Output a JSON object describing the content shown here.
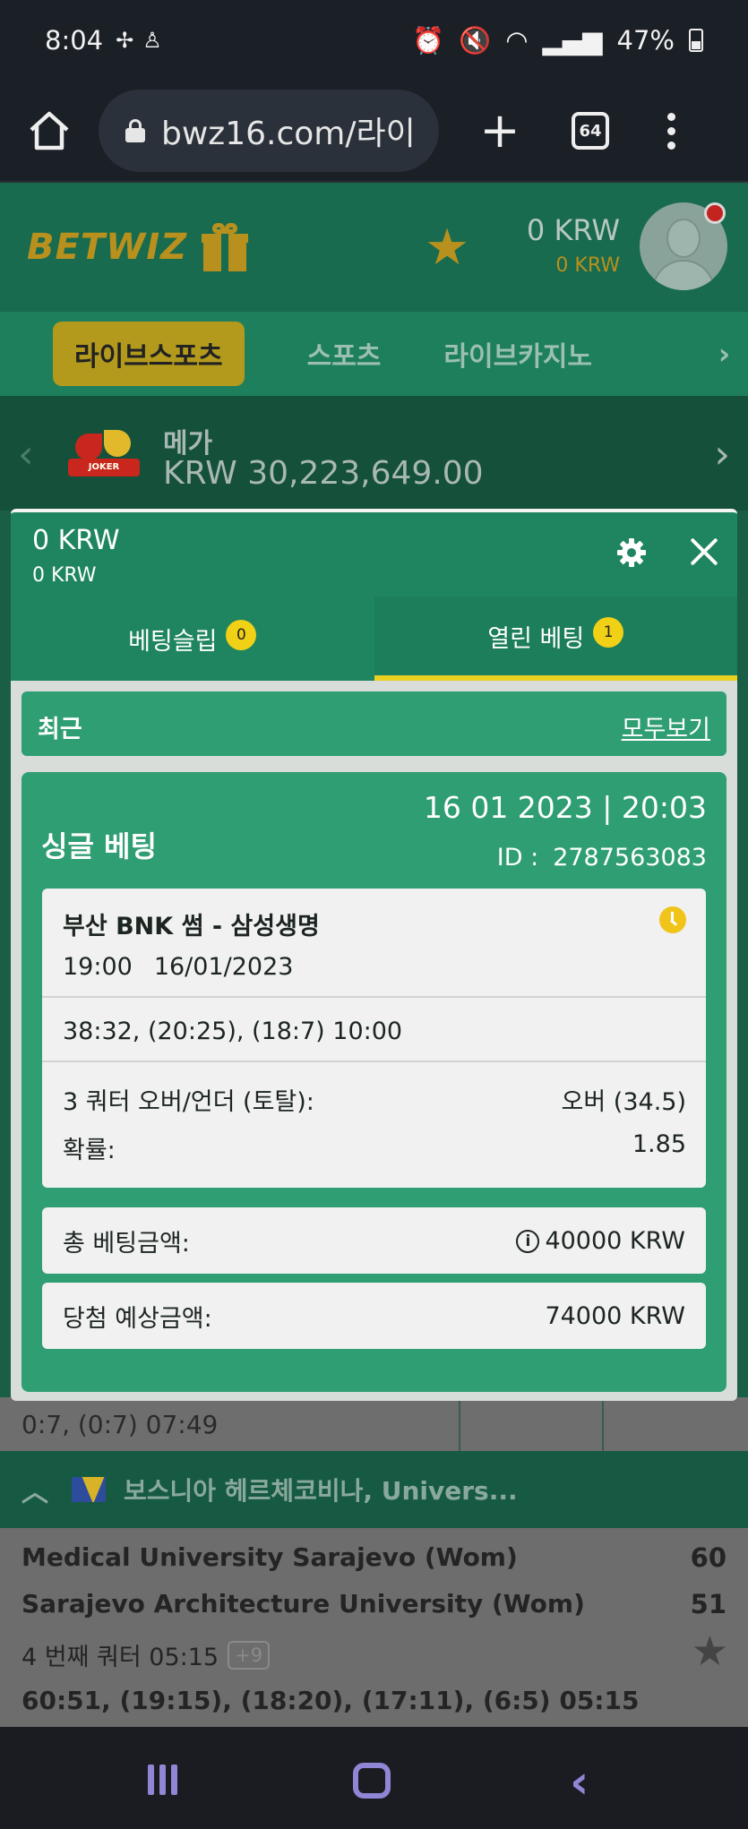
{
  "status_bar": {
    "time": "8:04",
    "battery": "47%"
  },
  "browser": {
    "url": "bwz16.com/라이",
    "tab_count": "64"
  },
  "header": {
    "logo": "BETWIZ",
    "balance_main": "0 KRW",
    "balance_sub": "0 KRW"
  },
  "nav": {
    "tabs": [
      "라이브스포츠",
      "스포츠",
      "라이브카지노"
    ]
  },
  "jackpot": {
    "logo_text": "JOKER",
    "title": "메가",
    "amount": "KRW 30,223,649.00"
  },
  "betslip": {
    "balance_main": "0 KRW",
    "balance_sub": "0 KRW",
    "tabs": [
      {
        "label": "베팅슬립",
        "badge": "0"
      },
      {
        "label": "열린 베팅",
        "badge": "1"
      }
    ],
    "recent_label": "최근",
    "view_all": "모두보기",
    "bet": {
      "type": "싱글 베팅",
      "datetime": "16 01 2023 | 20:03",
      "id_label": "ID :",
      "id_value": "2787563083",
      "event_name": "부산 BNK 썸 - 삼성생명",
      "event_time": "19:00",
      "event_date": "16/01/2023",
      "live_score": "38:32, (20:25), (18:7) 10:00",
      "market_label": "3 쿼터 오버/언더 (토탈):",
      "market_value": "오버 (34.5)",
      "odds_label": "확률:",
      "odds_value": "1.85",
      "stake_label": "총 베팅금액:",
      "stake_value": "40000 KRW",
      "payout_label": "당첨 예상금액:",
      "payout_value": "74000 KRW"
    }
  },
  "background": {
    "partial_score": "0:7, (0:7) 07:49",
    "league": "보스니아 헤르체코비나, Univers...",
    "match": {
      "team1": "Medical University Sarajevo (Wom)",
      "score1": "60",
      "team2": "Sarajevo Architecture University (Wom)",
      "score2": "51",
      "quarter": "4 번째 쿼터 05:15",
      "more_markets": "+9",
      "full_score": "60:51, (19:15), (18:20), (17:11), (6:5) 05:15"
    }
  },
  "colors": {
    "brand_green": "#1f8560",
    "accent_gold": "#b8901e",
    "active_underline": "#ecd020"
  }
}
